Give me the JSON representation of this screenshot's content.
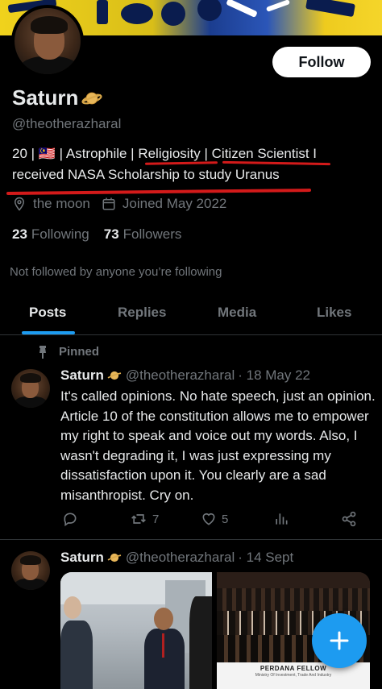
{
  "profile": {
    "name": "Saturn",
    "handle": "@theotherazharal",
    "follow_label": "Follow",
    "bio_line1": "20 | 🇲🇾 | Astrophile | Religiosity | Citizen Scientist I",
    "bio_line2": "received NASA Scholarship to study Uranus",
    "location": "the moon",
    "joined": "Joined May 2022",
    "following_count": "23",
    "following_label": "Following",
    "followers_count": "73",
    "followers_label": "Followers",
    "not_followed": "Not followed by anyone you’re following"
  },
  "tabs": [
    {
      "label": "Posts",
      "active": true
    },
    {
      "label": "Replies",
      "active": false
    },
    {
      "label": "Media",
      "active": false
    },
    {
      "label": "Likes",
      "active": false
    }
  ],
  "tweets": [
    {
      "pinned_label": "Pinned",
      "name": "Saturn",
      "handle": "@theotherazharal",
      "date": "· 18 May 22",
      "text": "It's called opinions. No hate speech, just an opinion. Article 10 of the constitution allows me to empower my right to speak and voice out my words. Also, I wasn't degrading it, I was just expressing my dissatisfaction upon it. You clearly are a sad misanthropist. Cry on.",
      "retweets": "7",
      "likes": "5"
    },
    {
      "name": "Saturn",
      "handle": "@theotherazharal",
      "date": "· 14 Sept",
      "image2_caption": "PERDANA FELLOW",
      "image2_subcaption": "Ministry Of Investment, Trade And Industry"
    }
  ],
  "colors": {
    "background": "#000000",
    "accent": "#1d9bf0",
    "text_primary": "#e7e9ea",
    "text_secondary": "#71767b",
    "annotation_red": "#d31a1a"
  },
  "icons": [
    "planet-emoji-icon",
    "location-pin-icon",
    "calendar-icon",
    "pin-icon",
    "reply-icon",
    "retweet-icon",
    "like-icon",
    "views-icon",
    "share-icon",
    "compose-plus-icon"
  ]
}
